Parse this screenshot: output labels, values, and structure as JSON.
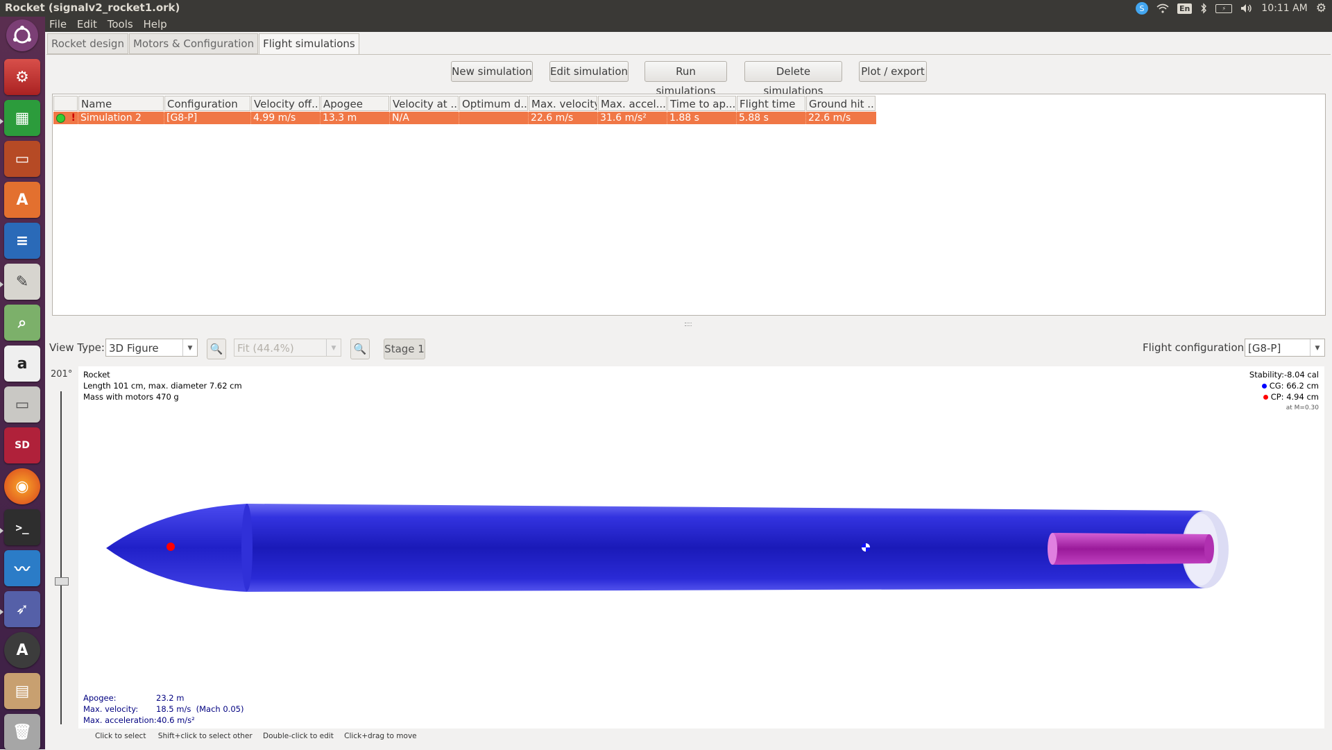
{
  "window_title": "Rocket (signalv2_rocket1.ork)",
  "topbar": {
    "keyboard": "En",
    "clock": "10:11 AM"
  },
  "menu": [
    "File",
    "Edit",
    "Tools",
    "Help"
  ],
  "tabs": [
    "Rocket design",
    "Motors & Configuration",
    "Flight simulations"
  ],
  "sim_buttons": {
    "new": "New simulation",
    "edit": "Edit simulation",
    "run": "Run simulations",
    "delete": "Delete simulations",
    "plot": "Plot / export"
  },
  "table": {
    "columns": [
      "Name",
      "Configuration",
      "Velocity off...",
      "Apogee",
      "Velocity at ...",
      "Optimum d...",
      "Max. velocity",
      "Max. accel...",
      "Time to ap...",
      "Flight time",
      "Ground hit ..."
    ],
    "rows": [
      {
        "status": "!",
        "cells": [
          "Simulation 2",
          "[G8-P]",
          "4.99 m/s",
          "13.3 m",
          "N/A",
          "",
          "22.6 m/s",
          "31.6 m/s²",
          "1.88 s",
          "5.88 s",
          "22.6 m/s"
        ]
      }
    ]
  },
  "view": {
    "view_type_label": "View Type:",
    "view_type_value": "3D Figure",
    "zoom_value": "Fit (44.4%)",
    "stage_label": "Stage 1",
    "flight_config_label": "Flight configuration:",
    "flight_config_value": "[G8-P]",
    "angle": "201°"
  },
  "figure": {
    "name": "Rocket",
    "length": "Length 101 cm, max. diameter 7.62 cm",
    "mass": "Mass with motors 470 g",
    "stability": "Stability:-8.04 cal",
    "cg": "CG: 66.2 cm",
    "cp": "CP: 4.94 cm",
    "mach": "at M=0.30",
    "apogee_label": "Apogee:",
    "apogee_value": "23.2 m",
    "maxvel_label": "Max. velocity:",
    "maxvel_value": "18.5 m/s  (Mach 0.05)",
    "maxacc_label": "Max. acceleration:",
    "maxacc_value": "40.6 m/s²",
    "colors": {
      "body": "#2424d8",
      "motor": "#c030c0",
      "cp_marker": "#ff0000",
      "cg_marker": "#0000ff"
    }
  },
  "hints": [
    "Click to select",
    "Shift+click to select other",
    "Double-click to edit",
    "Click+drag to move"
  ]
}
